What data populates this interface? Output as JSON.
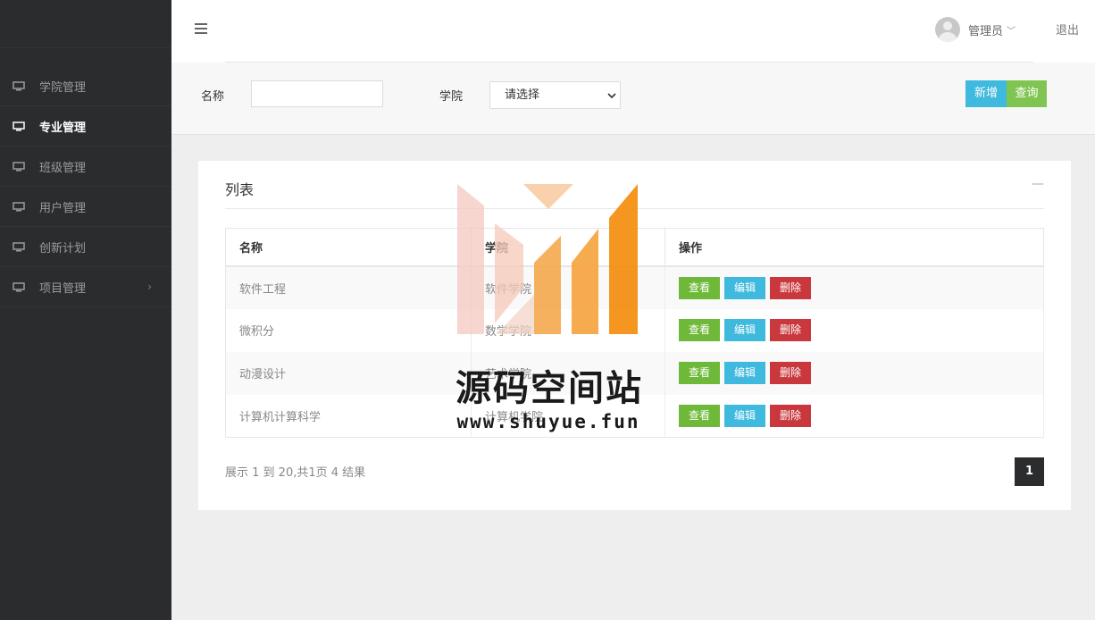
{
  "sidebar": {
    "items": [
      {
        "label": "学院管理",
        "active": false
      },
      {
        "label": "专业管理",
        "active": true
      },
      {
        "label": "班级管理",
        "active": false
      },
      {
        "label": "用户管理",
        "active": false
      },
      {
        "label": "创新计划",
        "active": false
      },
      {
        "label": "项目管理",
        "active": false,
        "has_children": true
      }
    ]
  },
  "header": {
    "user_name": "管理员",
    "logout_label": "退出"
  },
  "search": {
    "name_label": "名称",
    "name_value": "",
    "college_label": "学院",
    "college_selected": "请选择",
    "add_label": "新增",
    "query_label": "查询"
  },
  "list": {
    "title": "列表",
    "columns": [
      "名称",
      "学院",
      "操作"
    ],
    "rows": [
      {
        "name": "软件工程",
        "college": "软件学院"
      },
      {
        "name": "微积分",
        "college": "数学学院"
      },
      {
        "name": "动漫设计",
        "college": "艺术学院"
      },
      {
        "name": "计算机计算科学",
        "college": "计算机学院"
      }
    ],
    "actions": {
      "view": "查看",
      "edit": "编辑",
      "delete": "删除"
    },
    "summary": "展示 1 到 20,共1页 4 结果",
    "current_page": "1"
  },
  "watermark": {
    "title": "源码空间站",
    "url": "www.shuyue.fun"
  },
  "colors": {
    "sidebar_bg": "#2b2c2e",
    "add_button": "#3fb9dd",
    "query_button": "#80c551",
    "view_button": "#6fb93a",
    "edit_button": "#3fb9dd",
    "delete_button": "#c9383d"
  }
}
